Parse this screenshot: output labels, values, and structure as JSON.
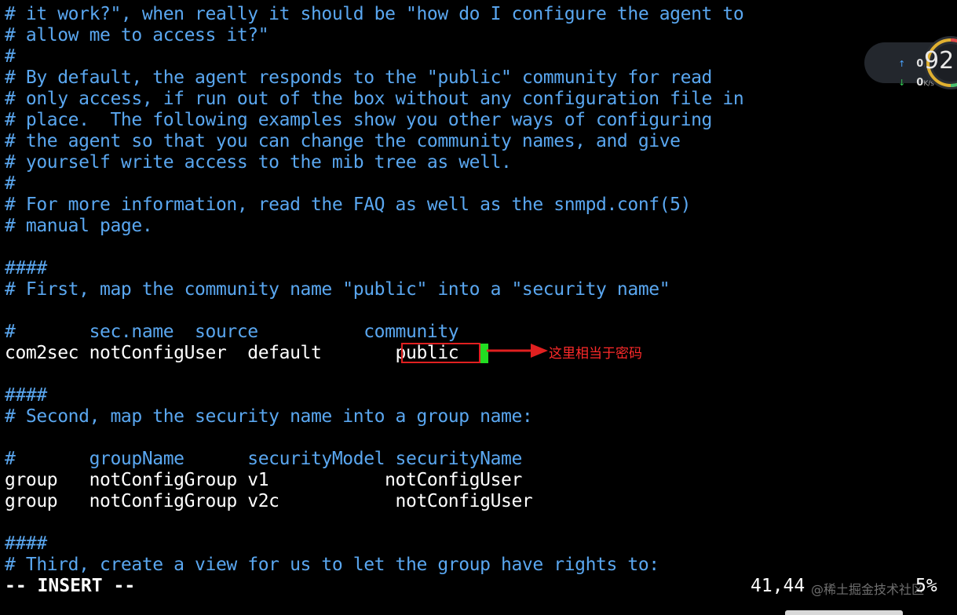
{
  "editor": {
    "lines": [
      {
        "text": "# it work?\", when really it should be \"how do I configure the agent to",
        "kind": "comment"
      },
      {
        "text": "# allow me to access it?\"",
        "kind": "comment"
      },
      {
        "text": "#",
        "kind": "comment"
      },
      {
        "text": "# By default, the agent responds to the \"public\" community for read",
        "kind": "comment"
      },
      {
        "text": "# only access, if run out of the box without any configuration file in",
        "kind": "comment"
      },
      {
        "text": "# place.  The following examples show you other ways of configuring",
        "kind": "comment"
      },
      {
        "text": "# the agent so that you can change the community names, and give",
        "kind": "comment"
      },
      {
        "text": "# yourself write access to the mib tree as well.",
        "kind": "comment"
      },
      {
        "text": "#",
        "kind": "comment"
      },
      {
        "text": "# For more information, read the FAQ as well as the snmpd.conf(5)",
        "kind": "comment"
      },
      {
        "text": "# manual page.",
        "kind": "comment"
      },
      {
        "text": "",
        "kind": "code"
      },
      {
        "text": "####",
        "kind": "comment"
      },
      {
        "text": "# First, map the community name \"public\" into a \"security name\"",
        "kind": "comment"
      },
      {
        "text": "",
        "kind": "code"
      },
      {
        "text": "#       sec.name  source          community",
        "kind": "comment"
      },
      {
        "text": "com2sec notConfigUser  default       public",
        "kind": "code"
      },
      {
        "text": "",
        "kind": "code"
      },
      {
        "text": "####",
        "kind": "comment"
      },
      {
        "text": "# Second, map the security name into a group name:",
        "kind": "comment"
      },
      {
        "text": "",
        "kind": "code"
      },
      {
        "text": "#       groupName      securityModel securityName",
        "kind": "comment"
      },
      {
        "text": "group   notConfigGroup v1           notConfigUser",
        "kind": "code"
      },
      {
        "text": "group   notConfigGroup v2c           notConfigUser",
        "kind": "code"
      },
      {
        "text": "",
        "kind": "code"
      },
      {
        "text": "####",
        "kind": "comment"
      },
      {
        "text": "# Third, create a view for us to let the group have rights to:",
        "kind": "comment"
      }
    ],
    "mode_text": "-- INSERT --",
    "cursor_position": "41,44",
    "scroll_percent": "5%"
  },
  "annotation": {
    "label": "这里相当于密码",
    "color": "#ff2a2a"
  },
  "watermark": "@稀土掘金技术社区",
  "net_widget": {
    "upload": "0",
    "download": "0",
    "unit": "K/s",
    "gauge_value": "92"
  },
  "colors": {
    "background": "#000000",
    "comment": "#5aa7f0",
    "code": "#ffffff",
    "cursor": "#22dd22",
    "highlight_box": "#e02020"
  }
}
